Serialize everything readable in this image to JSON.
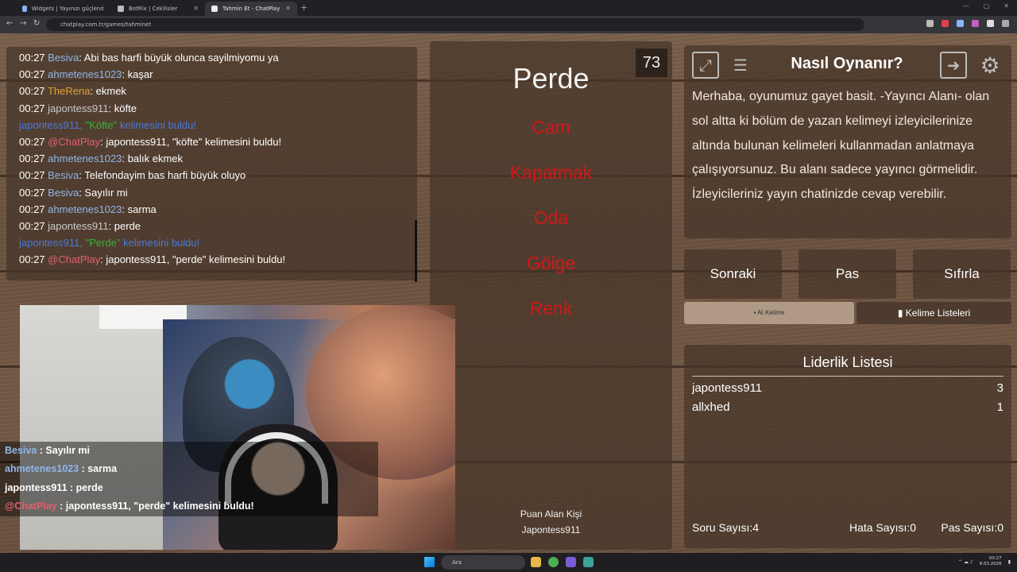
{
  "browser": {
    "tabs": [
      {
        "label": "Widgets | Yayınızı güçlendirmeye..."
      },
      {
        "label": "BotRix | Cekilisler"
      },
      {
        "label": "Tahmin Et - ChatPlay"
      }
    ],
    "url": "chatplay.com.tr/games/tahminet"
  },
  "chat": {
    "messages": [
      {
        "time": "00:27",
        "user": "Besiva",
        "color": "#8fb6e8",
        "text": ": Abi bas harfi büyük olunca sayilmiyomu ya"
      },
      {
        "time": "00:27",
        "user": "ahmetenes1023",
        "color": "#8fb6e8",
        "text": ": kaşar"
      },
      {
        "time": "00:27",
        "user": "TheRena",
        "color": "#e0a030",
        "text": ": ekmek"
      },
      {
        "time": "00:27",
        "user": "japontess911",
        "color": "#c8c8c8",
        "text": ": köfte"
      },
      {
        "system": true,
        "prefix": "japontess911, ",
        "word": "\"Köfte\"",
        "suffix": " kelimesini buldu!"
      },
      {
        "time": "00:27",
        "user": "@ChatPlay",
        "color": "#e06070",
        "text": ": japontess911, \"köfte\" kelimesini buldu!"
      },
      {
        "time": "00:27",
        "user": "ahmetenes1023",
        "color": "#8fb6e8",
        "text": ": balık ekmek"
      },
      {
        "time": "00:27",
        "user": "Besiva",
        "color": "#8fb6e8",
        "text": ": Telefondayim bas harfi büyük oluyo"
      },
      {
        "time": "00:27",
        "user": "Besiva",
        "color": "#8fb6e8",
        "text": ": Sayılır mi"
      },
      {
        "time": "00:27",
        "user": "ahmetenes1023",
        "color": "#8fb6e8",
        "text": ": sarma"
      },
      {
        "time": "00:27",
        "user": "japontess911",
        "color": "#c8c8c8",
        "text": ": perde"
      },
      {
        "system": true,
        "prefix": "japontess911, ",
        "word": "\"Perde\"",
        "suffix": " kelimesini buldu!"
      },
      {
        "time": "00:27",
        "user": "@ChatPlay",
        "color": "#e06070",
        "text": ": japontess911, \"perde\" kelimesini buldu!"
      }
    ]
  },
  "game": {
    "timer": "73",
    "main_word": "Perde",
    "taboo_words": [
      "Cam",
      "Kapatmak",
      "Oda",
      "Gölge",
      "Renk"
    ],
    "scorer_label": "Puan Alan Kişi",
    "scorer_name": "Japontess911"
  },
  "howto": {
    "title": "Nasıl Oynanır?",
    "text": "Merhaba, oyunumuz gayet basit. -Yayıncı Alanı- olan sol altta ki bölüm de yazan kelimeyi izleyicilerinize altında bulunan kelimeleri kullanmadan anlatmaya çalışıyorsunuz. Bu alanı sadece yayıncı görmelidir. İzleyicileriniz yayın chatinizde cevap verebilir."
  },
  "buttons": {
    "next": "Sonraki",
    "pass": "Pas",
    "reset": "Sıfırla",
    "ai_word": "AI Kelime",
    "word_lists": "Kelime Listeleri"
  },
  "leaderboard": {
    "title": "Liderlik Listesi",
    "rows": [
      {
        "name": "japontess911",
        "score": "3"
      },
      {
        "name": "allxhed",
        "score": "1"
      }
    ],
    "question_count": "Soru Sayısı:4",
    "error_count": "Hata Sayısı:0",
    "pass_count": "Pas Sayısı:0"
  },
  "overlay_chat": [
    {
      "user": "Besiva",
      "color": "#8fb6e8",
      "text": " : Sayılır mi"
    },
    {
      "user": "ahmetenes1023",
      "color": "#8fb6e8",
      "text": " : sarma"
    },
    {
      "user": "japontess911",
      "color": "#ffffff",
      "text": " : perde"
    },
    {
      "user": "@ChatPlay",
      "color": "#e06070",
      "text": " : japontess911, \"perde\" kelimesini buldu!"
    }
  ],
  "taskbar": {
    "search_placeholder": "Ara",
    "time": "00:27",
    "date": "8.03.2026"
  }
}
